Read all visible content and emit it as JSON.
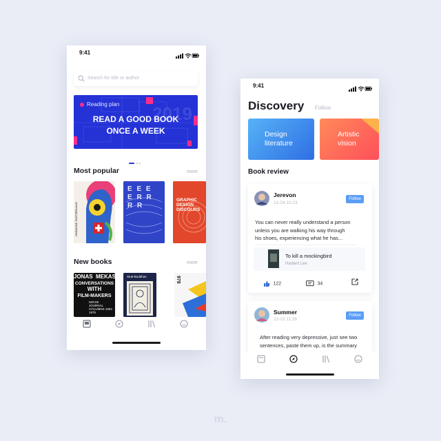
{
  "left_screen": {
    "status_time": "9:41",
    "search": {
      "placeholder": "Search for title or author"
    },
    "banner": {
      "tag": "Reading plan",
      "year": "2019",
      "headline_line1": "READ A GOOD BOOK",
      "headline_line2": "ONCE A WEEK",
      "carousel_page": 1,
      "carousel_pages": 3
    },
    "most_popular": {
      "title": "Most popular",
      "more_label": "more",
      "covers": [
        {
          "text": "PARADISE SWITZERLAND"
        },
        {
          "text": "E E E E R R R R"
        },
        {
          "text": "GRAPHIC DESIGN DISCOURS"
        }
      ]
    },
    "new_books": {
      "title": "New books",
      "more_label": "more",
      "covers": [
        {
          "line1": "JONAS",
          "line2": "MEKAS",
          "line3": "CONVERSATIONS",
          "line4": "WITH",
          "line5": "FILM-MAKERS",
          "line6": "MOVIE JOURNAL COLUMNS 1961-1975"
        },
        {
          "text": "Stutt-Buddhas"
        },
        {
          "text": "978"
        }
      ]
    },
    "tabbar": [
      "book-icon",
      "compass-icon",
      "library-icon",
      "profile-icon"
    ]
  },
  "right_screen": {
    "status_time": "9:41",
    "title": "Discovery",
    "follow_tab": "Follow",
    "categories": [
      {
        "line1": "Design",
        "line2": "literature",
        "color": "#3b8ff0"
      },
      {
        "line1": "Artistic",
        "line2": "vision",
        "color": "#ff6c4f"
      }
    ],
    "book_review_title": "Book review",
    "reviews": [
      {
        "user": "Jerevon",
        "date": "12-24 10:23",
        "follow_label": "Follow",
        "text_lines": [
          "You can never really understand a person",
          "unless you are walking his way through",
          "his shoes, experiencing what he has..."
        ],
        "book_title": "To kill a mockingbird",
        "book_author": "Harbert Lee",
        "likes": "122",
        "comments": "34"
      },
      {
        "user": "Summer",
        "date": "12-23 11:35",
        "follow_label": "Follow",
        "text_lines": [
          "After reading very depressive, just see two",
          "sentences, paste them up, is the summary"
        ]
      }
    ],
    "tabbar": [
      "book-icon",
      "compass-icon",
      "library-icon",
      "profile-icon"
    ]
  },
  "brand_mark": "m."
}
